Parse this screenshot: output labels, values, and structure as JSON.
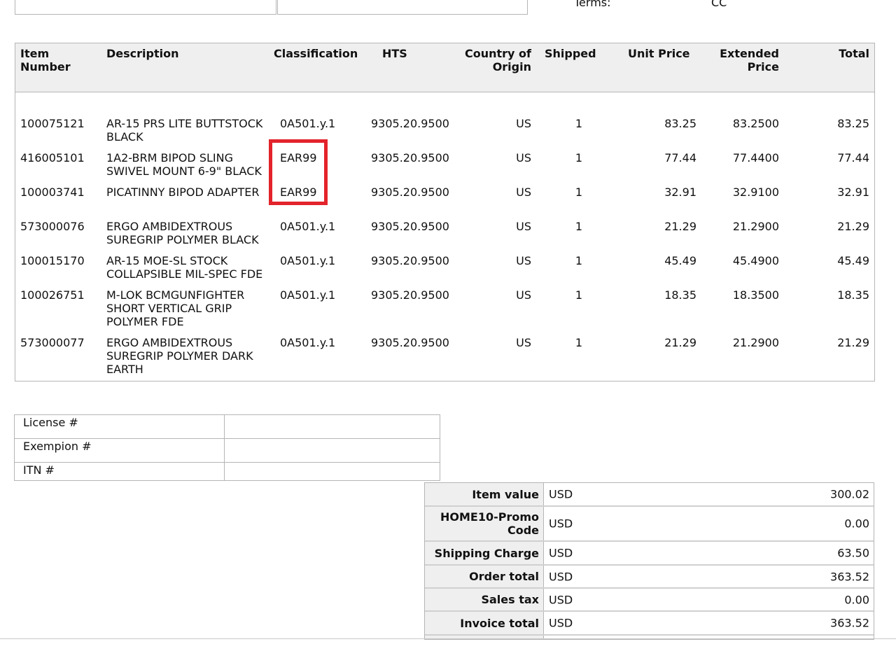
{
  "terms": {
    "label": "Terms:",
    "value": "CC"
  },
  "items_table": {
    "headers": {
      "item_number": "Item Number",
      "description": "Description",
      "classification": "Classification",
      "hts": "HTS",
      "country": "Country of Origin",
      "shipped": "Shipped",
      "unit_price": "Unit Price",
      "extended_price": "Extended Price",
      "total": "Total"
    },
    "rows": [
      {
        "item": "100075121",
        "description": "AR-15 PRS LITE BUTTSTOCK BLACK",
        "classification": "0A501.y.1",
        "hts": "9305.20.9500",
        "country": "US",
        "shipped": "1",
        "unit_price": "83.25",
        "extended_price": "83.2500",
        "total": "83.25"
      },
      {
        "item": "416005101",
        "description": "1A2-BRM BIPOD SLING SWIVEL MOUNT 6-9\" BLACK",
        "classification": "EAR99",
        "hts": "9305.20.9500",
        "country": "US",
        "shipped": "1",
        "unit_price": "77.44",
        "extended_price": "77.4400",
        "total": "77.44"
      },
      {
        "item": "100003741",
        "description": "PICATINNY BIPOD ADAPTER",
        "classification": "EAR99",
        "hts": "9305.20.9500",
        "country": "US",
        "shipped": "1",
        "unit_price": "32.91",
        "extended_price": "32.9100",
        "total": "32.91"
      },
      {
        "item": "573000076",
        "description": "ERGO AMBIDEXTROUS SUREGRIP POLYMER BLACK",
        "classification": "0A501.y.1",
        "hts": "9305.20.9500",
        "country": "US",
        "shipped": "1",
        "unit_price": "21.29",
        "extended_price": "21.2900",
        "total": "21.29"
      },
      {
        "item": "100015170",
        "description": "AR-15 MOE-SL STOCK COLLAPSIBLE MIL-SPEC FDE",
        "classification": "0A501.y.1",
        "hts": "9305.20.9500",
        "country": "US",
        "shipped": "1",
        "unit_price": "45.49",
        "extended_price": "45.4900",
        "total": "45.49"
      },
      {
        "item": "100026751",
        "description": "M-LOK BCMGUNFIGHTER SHORT VERTICAL GRIP POLYMER FDE",
        "classification": "0A501.y.1",
        "hts": "9305.20.9500",
        "country": "US",
        "shipped": "1",
        "unit_price": "18.35",
        "extended_price": "18.3500",
        "total": "18.35"
      },
      {
        "item": "573000077",
        "description": "ERGO AMBIDEXTROUS SUREGRIP POLYMER DARK EARTH",
        "classification": "0A501.y.1",
        "hts": "9305.20.9500",
        "country": "US",
        "shipped": "1",
        "unit_price": "21.29",
        "extended_price": "21.2900",
        "total": "21.29"
      }
    ],
    "highlight_color": "#e3232b"
  },
  "license_table": {
    "rows": [
      {
        "label": "License #",
        "value": ""
      },
      {
        "label": "Exempion #",
        "value": ""
      },
      {
        "label": "ITN #",
        "value": ""
      }
    ]
  },
  "totals": {
    "rows": [
      {
        "label": "Item value",
        "currency": "USD",
        "value": "300.02"
      },
      {
        "label": "HOME10-Promo Code",
        "currency": "USD",
        "value": "0.00"
      },
      {
        "label": "Shipping Charge",
        "currency": "USD",
        "value": "63.50"
      },
      {
        "label": "Order total",
        "currency": "USD",
        "value": "363.52"
      },
      {
        "label": "Sales tax",
        "currency": "USD",
        "value": "0.00"
      },
      {
        "label": "Invoice total",
        "currency": "USD",
        "value": "363.52"
      }
    ]
  }
}
